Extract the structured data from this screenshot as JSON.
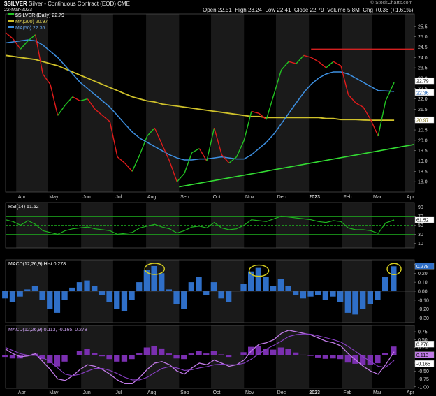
{
  "header": {
    "symbol": "$SILVER",
    "name": "Silver - Continuous Contract (EOD)",
    "exchange": "CME",
    "date": "22-Mar-2023",
    "open_label": "Open",
    "open": "22.51",
    "high_label": "High",
    "high": "23.24",
    "low_label": "Low",
    "low": "22.41",
    "close_label": "Close",
    "close": "22.79",
    "volume_label": "Volume",
    "volume": "5.8M",
    "chg_label": "Chg",
    "chg": "+0.36 (+1.61%)",
    "watermark": "© StockCharts.com"
  },
  "legend": {
    "price": "$SILVER (Daily) 22.79",
    "ma200": "MA(200) 20.97",
    "ma50": "MA(50) 22.36",
    "rsi": "RSI(14) 61.52",
    "macd_hist": "MACD(12,26,9) Hist 0.278",
    "macd": "MACD(12,26,9) 0.113, -0.165, 0.278"
  },
  "x_axis": {
    "labels": [
      "Apr",
      "May",
      "Jun",
      "Jul",
      "Aug",
      "Sep",
      "Oct",
      "Nov",
      "Dec",
      "2023",
      "Feb",
      "Mar",
      "Apr"
    ]
  },
  "badges": {
    "price_close": "22.79",
    "ma50": "22.36",
    "ma200": "20.97",
    "rsi": "61.52",
    "hist": "0.278",
    "macd_hist": "0.278",
    "macd_line": "0.113",
    "macd_signal": "-0.165"
  },
  "colors": {
    "up": "#22c422",
    "down": "#e01b1b",
    "ma50": "#3d8fe0",
    "ma200": "#cfc12a",
    "rsi": "#1fb21f",
    "hist": "#2f6fc8",
    "macd": "#c27be8",
    "signal": "#8a3fc7",
    "support": "#33dd33",
    "resistance": "#d42020",
    "highlight": "#d8d020"
  },
  "chart_data": [
    {
      "panel": "price",
      "type": "line",
      "yaxis_ticks": [
        "25.5",
        "25.0",
        "24.5",
        "24.0",
        "23.5",
        "23.0",
        "22.5",
        "22.0",
        "21.5",
        "21.0",
        "20.5",
        "20.0",
        "19.5",
        "19.0",
        "18.5",
        "18.0"
      ],
      "ylim": [
        17.5,
        26.1
      ],
      "x": [
        "2022-03-22",
        "2022-03-29",
        "2022-04-05",
        "2022-04-12",
        "2022-04-19",
        "2022-04-26",
        "2022-05-03",
        "2022-05-10",
        "2022-05-17",
        "2022-05-24",
        "2022-05-31",
        "2022-06-07",
        "2022-06-14",
        "2022-06-21",
        "2022-06-28",
        "2022-07-05",
        "2022-07-12",
        "2022-07-19",
        "2022-07-26",
        "2022-08-02",
        "2022-08-09",
        "2022-08-16",
        "2022-08-23",
        "2022-08-30",
        "2022-09-06",
        "2022-09-13",
        "2022-09-20",
        "2022-09-27",
        "2022-10-04",
        "2022-10-11",
        "2022-10-18",
        "2022-10-25",
        "2022-11-01",
        "2022-11-08",
        "2022-11-15",
        "2022-11-22",
        "2022-11-29",
        "2022-12-06",
        "2022-12-13",
        "2022-12-20",
        "2022-12-27",
        "2023-01-03",
        "2023-01-10",
        "2023-01-17",
        "2023-01-24",
        "2023-01-31",
        "2023-02-07",
        "2023-02-14",
        "2023-02-21",
        "2023-02-28",
        "2023-03-07",
        "2023-03-14",
        "2023-03-22"
      ],
      "series": [
        {
          "name": "$SILVER (Daily)",
          "values": [
            25.2,
            24.9,
            24.4,
            24.8,
            25.1,
            23.2,
            22.7,
            21.2,
            21.7,
            22.1,
            21.9,
            22.0,
            21.5,
            21.2,
            20.9,
            19.2,
            18.9,
            18.5,
            19.3,
            20.2,
            20.6,
            19.8,
            19.0,
            18.0,
            18.4,
            19.4,
            19.6,
            19.0,
            20.6,
            19.3,
            18.9,
            19.2,
            20.0,
            21.4,
            21.3,
            21.0,
            22.2,
            23.4,
            23.8,
            23.7,
            24.1,
            24.0,
            23.8,
            23.5,
            23.8,
            23.6,
            22.2,
            21.8,
            21.6,
            21.0,
            20.2,
            21.9,
            22.79
          ]
        },
        {
          "name": "MA(200)",
          "values": [
            24.1,
            24.05,
            24.0,
            23.95,
            23.9,
            23.8,
            23.7,
            23.6,
            23.45,
            23.3,
            23.15,
            23.0,
            22.85,
            22.7,
            22.55,
            22.4,
            22.25,
            22.1,
            22.0,
            21.9,
            21.85,
            21.75,
            21.7,
            21.65,
            21.6,
            21.55,
            21.5,
            21.45,
            21.4,
            21.35,
            21.3,
            21.25,
            21.2,
            21.15,
            21.15,
            21.1,
            21.1,
            21.1,
            21.1,
            21.1,
            21.1,
            21.1,
            21.1,
            21.05,
            21.05,
            21.0,
            21.0,
            21.0,
            20.98,
            20.97,
            20.97,
            20.97,
            20.97
          ]
        },
        {
          "name": "MA(50)",
          "values": [
            24.7,
            24.75,
            24.8,
            24.85,
            24.8,
            24.6,
            24.3,
            24.0,
            23.6,
            23.2,
            22.8,
            22.5,
            22.2,
            21.9,
            21.6,
            21.2,
            20.8,
            20.4,
            20.1,
            19.9,
            19.7,
            19.5,
            19.3,
            19.15,
            19.05,
            19.05,
            19.1,
            19.1,
            19.15,
            19.2,
            19.15,
            19.1,
            19.1,
            19.3,
            19.6,
            19.9,
            20.3,
            20.8,
            21.3,
            21.8,
            22.3,
            22.7,
            23.0,
            23.2,
            23.3,
            23.3,
            23.2,
            23.0,
            22.8,
            22.6,
            22.4,
            22.38,
            22.36
          ]
        }
      ],
      "annotations": [
        {
          "type": "resistance",
          "value": 24.4,
          "from": "2023-01-03",
          "to": "2023-04-10"
        },
        {
          "type": "support",
          "from": [
            "2022-09-01",
            17.75
          ],
          "to": [
            "2023-04-10",
            19.8
          ]
        }
      ]
    },
    {
      "panel": "rsi",
      "type": "line",
      "title": "RSI(14) 61.52",
      "yaxis_ticks": [
        "90",
        "70",
        "50",
        "30",
        "10"
      ],
      "ylim": [
        0,
        100
      ],
      "levels": [
        70,
        50,
        30
      ],
      "values": [
        62,
        58,
        50,
        60,
        52,
        38,
        34,
        30,
        38,
        42,
        44,
        46,
        42,
        40,
        38,
        30,
        32,
        34,
        44,
        48,
        52,
        46,
        42,
        33,
        38,
        46,
        48,
        44,
        56,
        44,
        40,
        42,
        50,
        62,
        60,
        58,
        64,
        70,
        68,
        66,
        64,
        62,
        58,
        56,
        60,
        58,
        44,
        40,
        40,
        38,
        32,
        55,
        61.52
      ]
    },
    {
      "panel": "macd_hist",
      "type": "bar",
      "title": "MACD(12,26,9) Hist 0.278",
      "yaxis_ticks": [
        "0.30",
        "0.20",
        "0.10",
        "0.00",
        "-0.10",
        "-0.20",
        "-0.30"
      ],
      "ylim": [
        -0.35,
        0.35
      ],
      "values": [
        -0.08,
        -0.12,
        -0.06,
        0.02,
        0.06,
        -0.1,
        -0.2,
        -0.24,
        -0.1,
        0.04,
        0.1,
        0.12,
        0.06,
        -0.04,
        -0.12,
        -0.2,
        -0.22,
        -0.1,
        0.1,
        0.24,
        0.28,
        0.2,
        0.02,
        -0.14,
        -0.2,
        0.1,
        0.16,
        -0.04,
        0.1,
        -0.08,
        -0.12,
        0.0,
        0.08,
        0.22,
        0.26,
        0.16,
        0.06,
        0.14,
        0.06,
        -0.04,
        -0.08,
        -0.06,
        -0.04,
        -0.1,
        -0.06,
        -0.12,
        -0.24,
        -0.26,
        -0.2,
        -0.14,
        -0.1,
        0.16,
        0.278
      ],
      "highlights": [
        "2022-08-09",
        "2022-11-15",
        "2023-03-22"
      ]
    },
    {
      "panel": "macd",
      "type": "line",
      "title": "MACD(12,26,9) 0.113, -0.165, 0.278",
      "yaxis_ticks": [
        "0.75",
        "0.50",
        "0.25",
        "0.00",
        "-0.25",
        "-0.50",
        "-0.75",
        "-1.00"
      ],
      "ylim": [
        -1.05,
        0.95
      ],
      "series": [
        {
          "name": "MACD",
          "values": [
            0.2,
            0.05,
            -0.05,
            -0.02,
            0.05,
            -0.2,
            -0.45,
            -0.75,
            -0.8,
            -0.65,
            -0.45,
            -0.3,
            -0.35,
            -0.45,
            -0.6,
            -0.78,
            -0.9,
            -0.9,
            -0.7,
            -0.45,
            -0.25,
            -0.2,
            -0.3,
            -0.5,
            -0.6,
            -0.4,
            -0.25,
            -0.3,
            -0.15,
            -0.25,
            -0.35,
            -0.3,
            -0.15,
            0.15,
            0.35,
            0.4,
            0.5,
            0.7,
            0.8,
            0.75,
            0.7,
            0.65,
            0.55,
            0.45,
            0.4,
            0.3,
            0.05,
            -0.15,
            -0.35,
            -0.5,
            -0.6,
            -0.3,
            0.113
          ]
        },
        {
          "name": "Signal",
          "values": [
            0.25,
            0.15,
            0.05,
            0.0,
            0.0,
            -0.08,
            -0.2,
            -0.4,
            -0.6,
            -0.65,
            -0.6,
            -0.5,
            -0.42,
            -0.42,
            -0.48,
            -0.58,
            -0.7,
            -0.78,
            -0.78,
            -0.7,
            -0.55,
            -0.42,
            -0.36,
            -0.4,
            -0.48,
            -0.46,
            -0.4,
            -0.36,
            -0.3,
            -0.28,
            -0.3,
            -0.3,
            -0.25,
            -0.12,
            0.05,
            0.2,
            0.32,
            0.45,
            0.6,
            0.66,
            0.68,
            0.67,
            0.62,
            0.56,
            0.5,
            0.42,
            0.28,
            0.12,
            -0.05,
            -0.2,
            -0.35,
            -0.38,
            -0.165
          ]
        }
      ]
    }
  ]
}
